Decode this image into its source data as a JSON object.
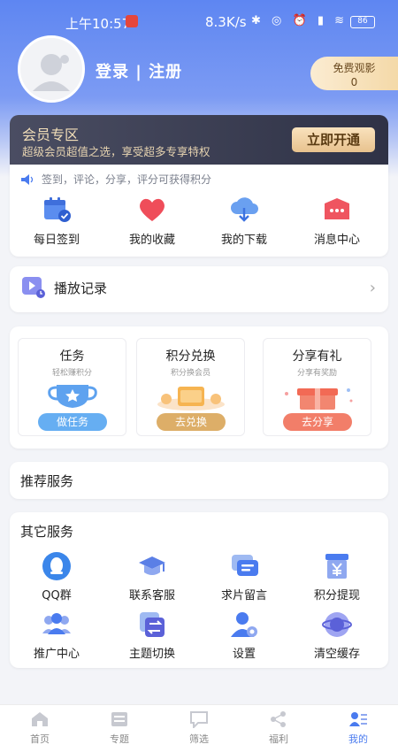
{
  "status": {
    "time": "上午10:57",
    "speed": "8.3K/s",
    "battery": "86"
  },
  "header": {
    "login": "登录 | 注册",
    "free_title": "免费观影",
    "free_count": "0"
  },
  "vip": {
    "title": "会员专区",
    "subtitle": "超级会员超值之选，享受超多专享特权",
    "button": "立即开通"
  },
  "notice": "签到，评论，分享，评分可获得积分",
  "quick_items": [
    {
      "label": "每日签到",
      "icon": "calendar-check-icon"
    },
    {
      "label": "我的收藏",
      "icon": "heart-icon"
    },
    {
      "label": "我的下载",
      "icon": "cloud-download-icon"
    },
    {
      "label": "消息中心",
      "icon": "message-icon"
    }
  ],
  "history": {
    "label": "播放记录"
  },
  "tasks": [
    {
      "title": "任务",
      "sub": "轻松赚积分",
      "button": "做任务"
    },
    {
      "title": "积分兑换",
      "sub": "积分换会员",
      "button": "去兑换"
    },
    {
      "title": "分享有礼",
      "sub": "分享有奖励",
      "button": "去分享"
    }
  ],
  "recommend": {
    "title": "推荐服务"
  },
  "others": {
    "title": "其它服务",
    "items": [
      {
        "label": "QQ群",
        "icon": "qq-icon"
      },
      {
        "label": "联系客服",
        "icon": "graduation-cap-icon"
      },
      {
        "label": "求片留言",
        "icon": "chat-bubble-icon"
      },
      {
        "label": "积分提现",
        "icon": "yuan-icon"
      },
      {
        "label": "推广中心",
        "icon": "group-icon"
      },
      {
        "label": "主题切换",
        "icon": "switch-icon"
      },
      {
        "label": "设置",
        "icon": "user-settings-icon"
      },
      {
        "label": "清空缓存",
        "icon": "clear-cache-icon"
      }
    ]
  },
  "tabbar": [
    {
      "label": "首页",
      "icon": "home-icon"
    },
    {
      "label": "专题",
      "icon": "topic-icon"
    },
    {
      "label": "筛选",
      "icon": "filter-icon"
    },
    {
      "label": "福利",
      "icon": "share-icon"
    },
    {
      "label": "我的",
      "icon": "profile-icon",
      "active": true
    }
  ],
  "colors": {
    "accent": "#4a7bef",
    "hero": "#5e86f2",
    "vip_bg": "#2f3246",
    "vip_gold": "#f3dfb9"
  }
}
